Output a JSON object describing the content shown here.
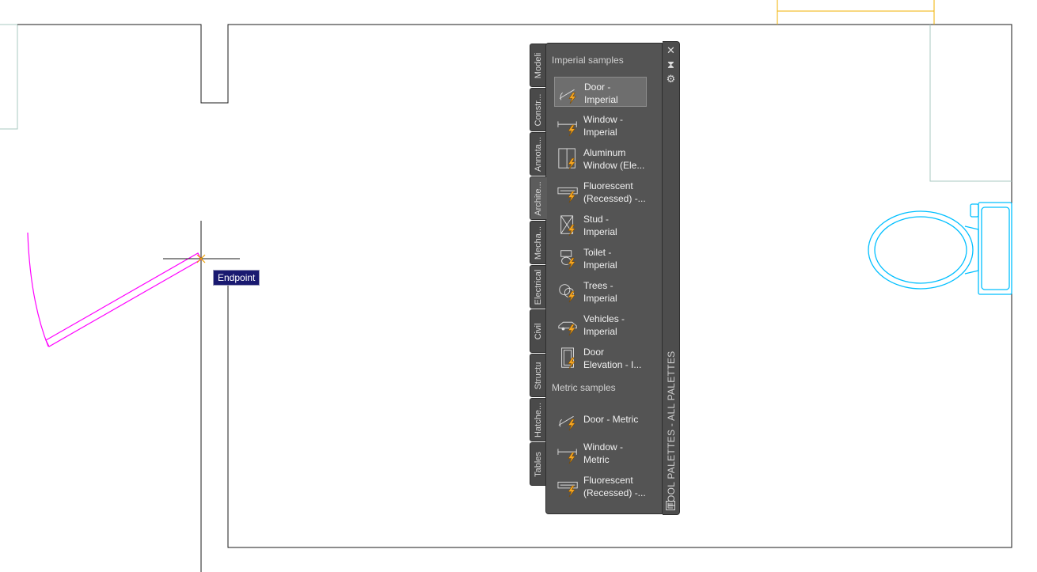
{
  "drawing": {
    "snap_tooltip": "Endpoint"
  },
  "palette": {
    "title": "TOOL PALETTES - ALL PALETTES",
    "tabs": [
      {
        "label": "Modeli"
      },
      {
        "label": "Constr..."
      },
      {
        "label": "Annota..."
      },
      {
        "label": "Archite...",
        "active": true
      },
      {
        "label": "Mecha..."
      },
      {
        "label": "Electrical"
      },
      {
        "label": "Civil"
      },
      {
        "label": "Structu"
      },
      {
        "label": "Hatche..."
      },
      {
        "label": "Tables"
      }
    ],
    "sections": [
      {
        "header": "Imperial samples",
        "tools": [
          {
            "l1": "Door -",
            "l2": "Imperial",
            "icon": "door-icon",
            "selected": true
          },
          {
            "l1": "Window -",
            "l2": "Imperial",
            "icon": "window-icon"
          },
          {
            "l1": "Aluminum",
            "l2": "Window (Ele...",
            "icon": "aluminum-window-icon"
          },
          {
            "l1": "Fluorescent",
            "l2": "(Recessed) -...",
            "icon": "fluorescent-light-icon"
          },
          {
            "l1": "Stud -",
            "l2": "Imperial",
            "icon": "stud-icon"
          },
          {
            "l1": "Toilet -",
            "l2": "Imperial",
            "icon": "toilet-icon"
          },
          {
            "l1": "Trees -",
            "l2": "Imperial",
            "icon": "trees-icon"
          },
          {
            "l1": "Vehicles -",
            "l2": "Imperial",
            "icon": "vehicle-icon"
          },
          {
            "l1": "Door",
            "l2": "Elevation - I...",
            "icon": "door-elevation-icon"
          }
        ]
      },
      {
        "header": "Metric samples",
        "tools": [
          {
            "l1": "Door - Metric",
            "l2": "",
            "icon": "door-icon"
          },
          {
            "l1": "Window -",
            "l2": "Metric",
            "icon": "window-icon"
          },
          {
            "l1": "Fluorescent",
            "l2": "(Recessed) -...",
            "icon": "fluorescent-light-icon"
          }
        ]
      }
    ],
    "buttons": {
      "close": "✕",
      "autohide": "⧗",
      "properties": "⚙"
    }
  },
  "colors": {
    "wall": "#1a1a1a",
    "door_swing": "#ff00ff",
    "fixture": "#00bfff",
    "cabinet": "#a8c8c0",
    "element_yellow": "#f0b000"
  }
}
